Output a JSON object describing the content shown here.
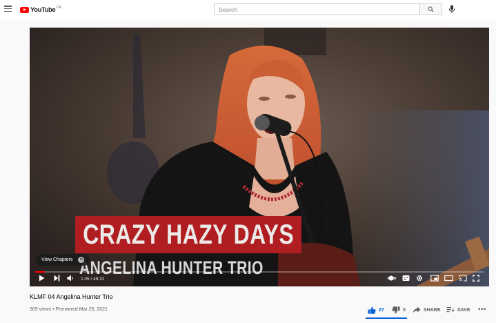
{
  "header": {
    "logo_text": "YouTube",
    "logo_country": "CA",
    "search_placeholder": "Search"
  },
  "video": {
    "banner_title": "CRAZY HAZY DAYS",
    "banner_subtitle": "ANGELINA HUNTER TRIO",
    "chapters_label": "View Chapters",
    "time": "1:05 / 49:32",
    "progress_fraction": 0.022
  },
  "info": {
    "title": "KLMF 04 Angelina Hunter Trio",
    "meta": "309 views • Premiered Mar 25, 2021",
    "like_count": "27",
    "dislike_count": "0",
    "share_label": "SHARE",
    "save_label": "SAVE"
  },
  "colors": {
    "brand": "#ff0000",
    "accent": "#065fd4",
    "banner": "#b01e21"
  }
}
